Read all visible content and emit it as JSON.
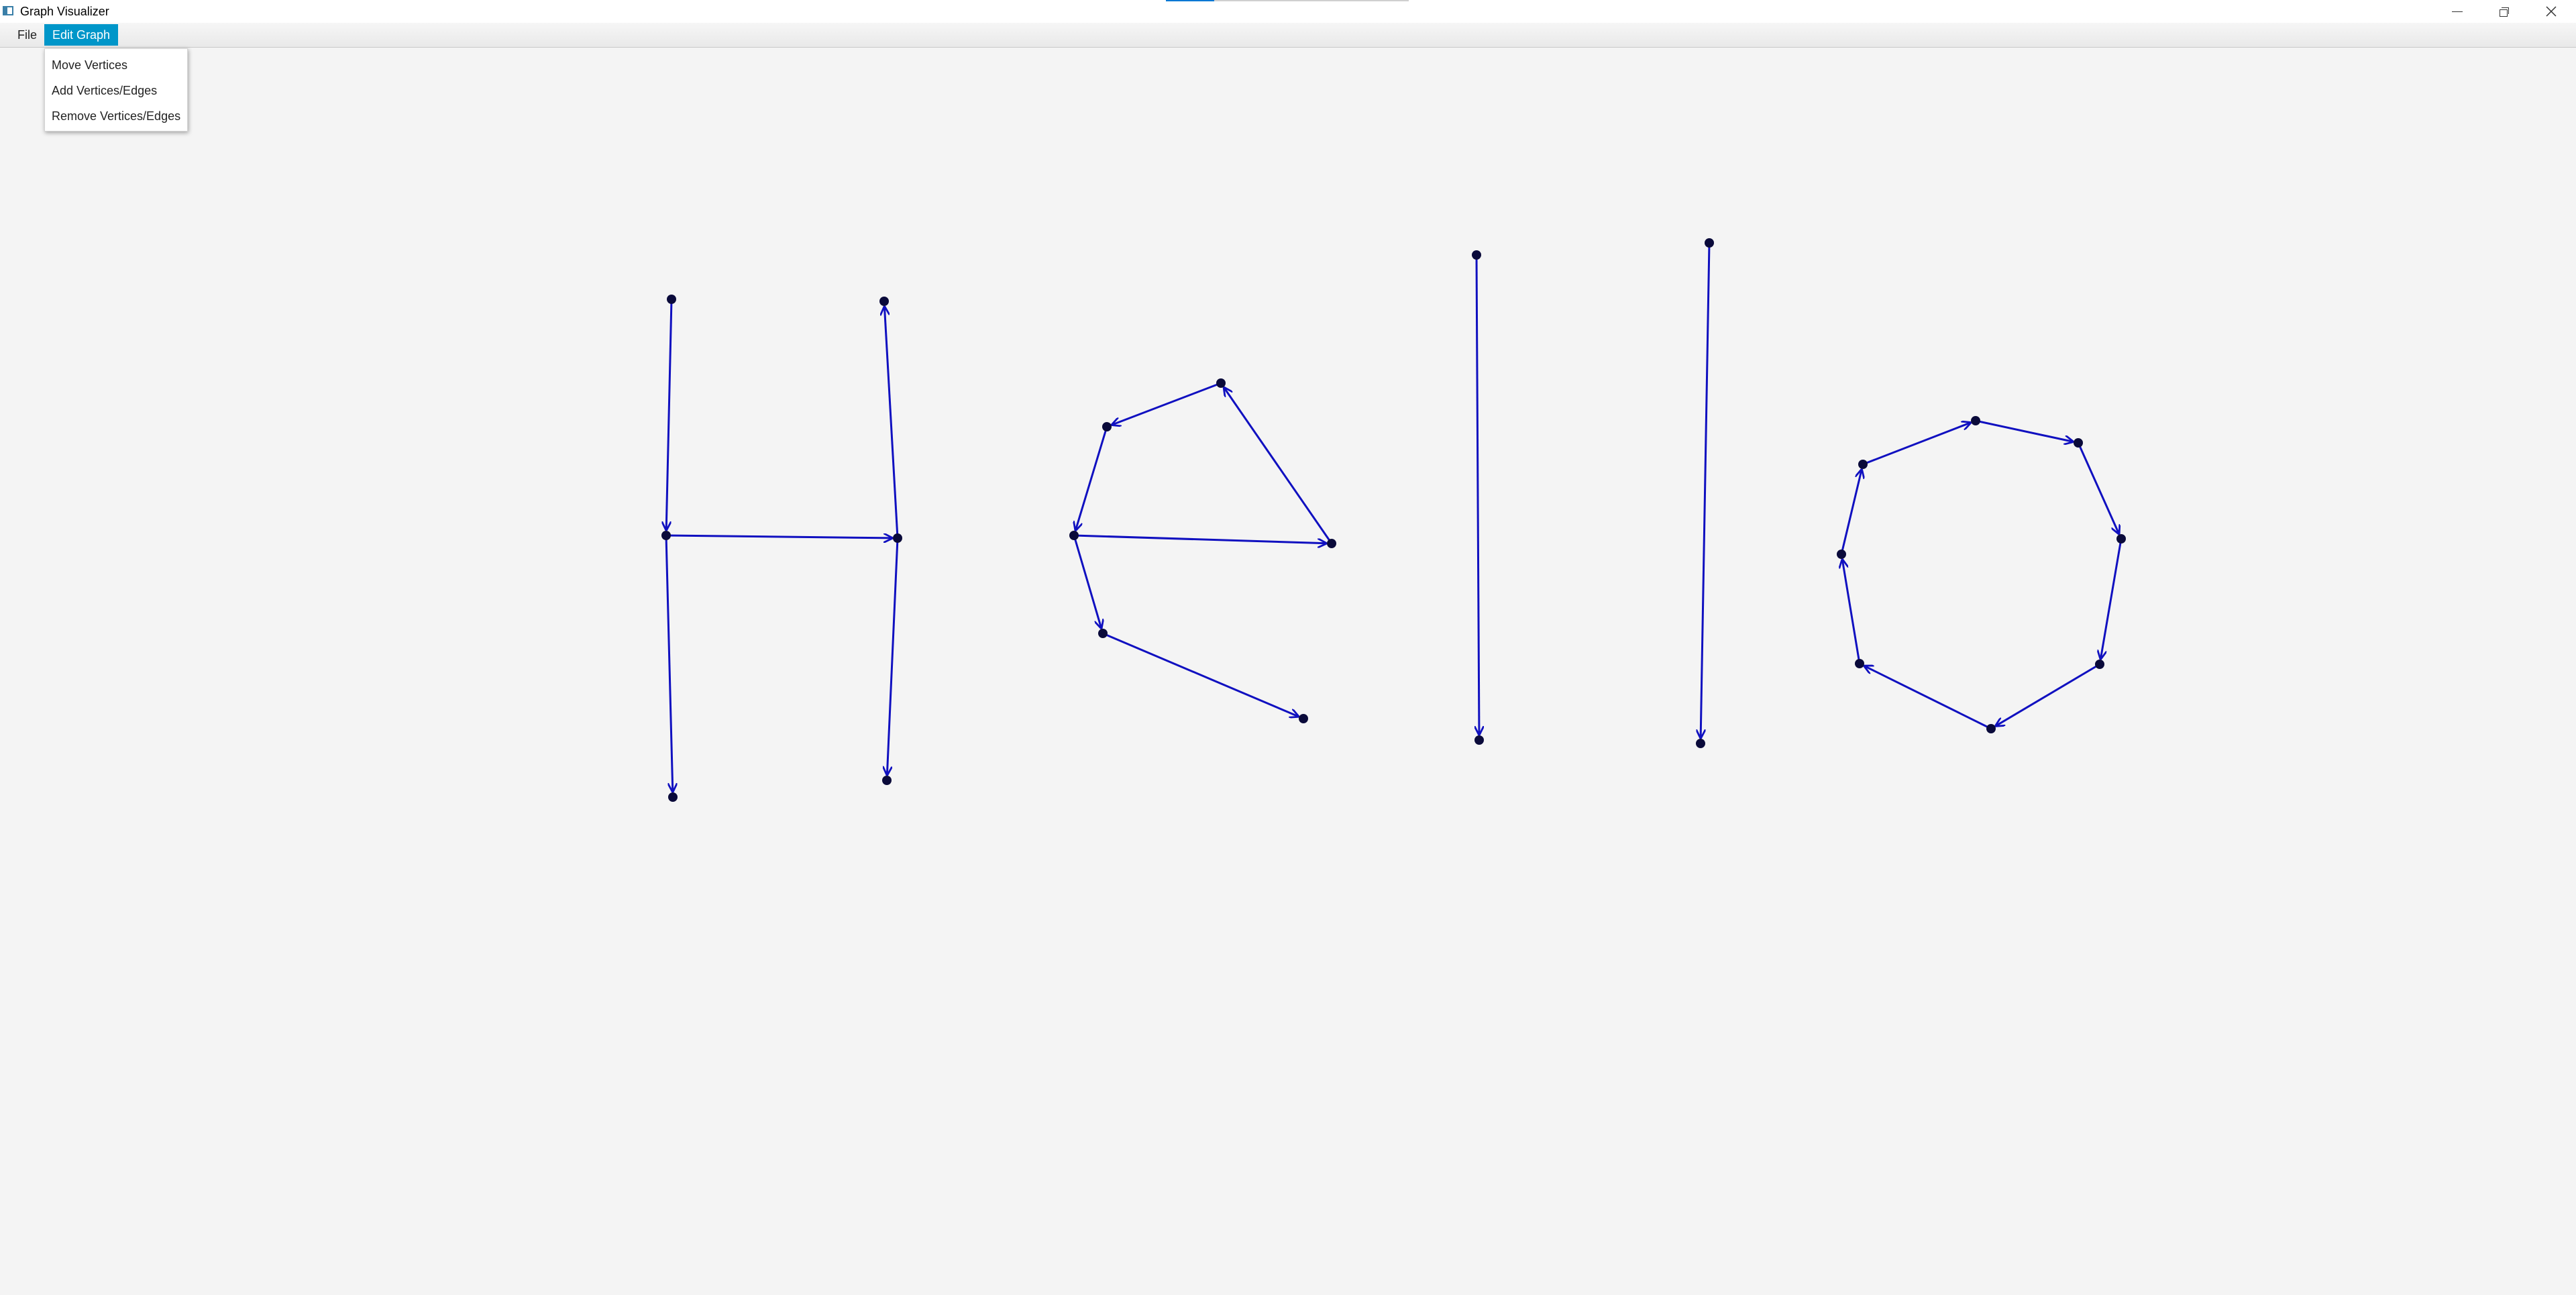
{
  "window": {
    "title": "Graph Visualizer",
    "minimize_icon": "minimize-icon",
    "maximize_icon": "restore-icon",
    "close_icon": "close-icon"
  },
  "menubar": {
    "file_label": "File",
    "edit_label": "Edit Graph",
    "active_color": "#0096c9"
  },
  "dropdown": {
    "items": [
      {
        "label": "Move Vertices"
      },
      {
        "label": "Add Vertices/Edges"
      },
      {
        "label": "Remove Vertices/Edges"
      }
    ]
  },
  "graph": {
    "edge_color": "#1010c0",
    "vertex_color": "#0a0a3a"
  }
}
